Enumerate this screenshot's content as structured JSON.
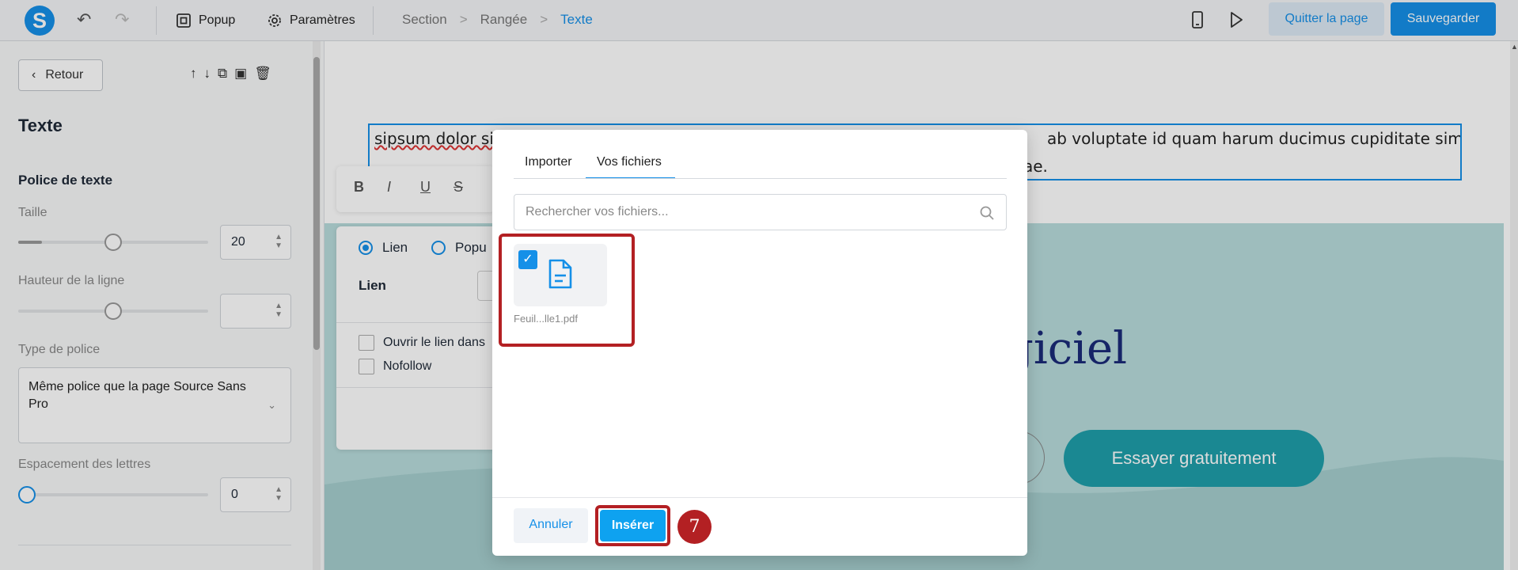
{
  "topbar": {
    "logo_letter": "S",
    "undo_icon": "↶",
    "redo_icon": "↷",
    "popup_label": "Popup",
    "settings_label": "Paramètres",
    "breadcrumb": [
      "Section",
      "Rangée",
      "Texte"
    ],
    "breadcrumb_sep": ">",
    "quit_label": "Quitter la page",
    "save_label": "Sauvegarder"
  },
  "sidebar": {
    "back_label": "Retour",
    "title": "Texte",
    "font_section": "Police de texte",
    "size_label": "Taille",
    "size_value": "20",
    "line_height_label": "Hauteur de la ligne",
    "font_type_label": "Type de police",
    "font_type_value": "Même police que la page Source Sans Pro",
    "letter_spacing_label": "Espacement des lettres",
    "letter_spacing_value": "0"
  },
  "canvas": {
    "text_line1_left": "sipsum dolor sit",
    "text_line1_right": "ab voluptate id quam harum ducimus cupiditate similique",
    "text_line2_right": "ae.",
    "headline_fragment": "giciel",
    "cta_label": "Essayer gratuitement"
  },
  "link_panel": {
    "opt_link": "Lien",
    "opt_popup": "Popu",
    "link_label": "Lien",
    "open_new": "Ouvrir le lien dans",
    "nofollow": "Nofollow"
  },
  "modal": {
    "tabs": [
      "Importer",
      "Vos fichiers"
    ],
    "search_placeholder": "Rechercher vos fichiers...",
    "file_name": "Feuil...lle1.pdf",
    "cancel_label": "Annuler",
    "insert_label": "Insérer",
    "step_number": "7"
  },
  "colors": {
    "accent": "#1590e8",
    "highlight": "#b32023",
    "teal": "#1f9fab"
  }
}
